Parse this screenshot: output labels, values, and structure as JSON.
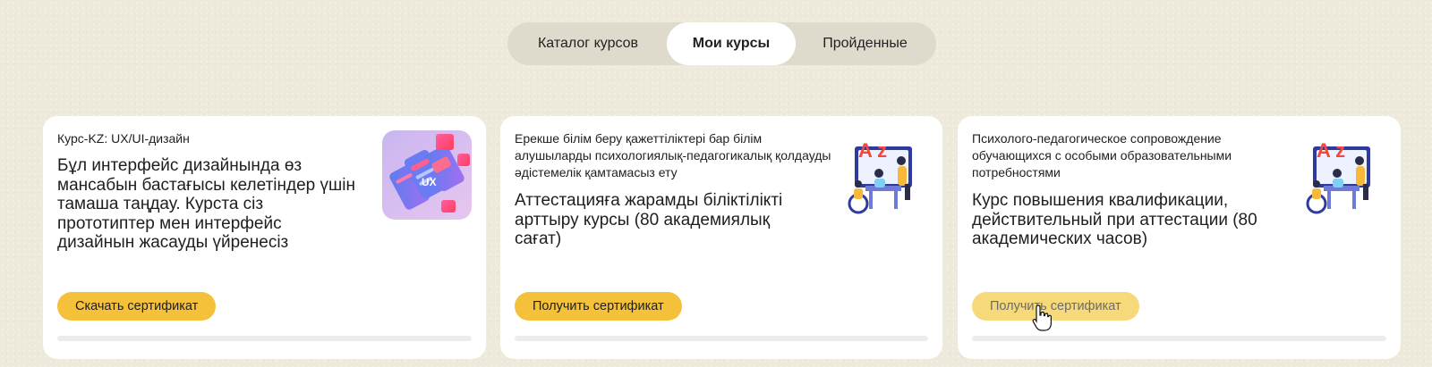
{
  "tabs": {
    "catalog": "Каталог курсов",
    "my": "Мои курсы",
    "done": "Пройденные"
  },
  "cards": [
    {
      "subtitle": "Курс-KZ: UX/UI-дизайн",
      "description": "Бұл интерфейс дизайнында өз мансабын бастағысы келетіндер үшін тамаша таңдау. Курста сіз прототиптер мен интерфейс дизайнын жасауды үйренесіз",
      "button": "Скачать сертификат",
      "thumb_icon": "ux-ui-phones-illustration"
    },
    {
      "subtitle": "Ерекше білім беру қажеттіліктері бар білім алушыларды психологиялық-педагогикалық қолдауды әдістемелік қамтамасыз ету",
      "description": "Аттестацияға жарамды біліктілікті арттыру курсы (80 академиялық сағат)",
      "button": "Получить сертификат",
      "thumb_icon": "classroom-az-illustration"
    },
    {
      "subtitle": "Психолого-педагогическое сопровождение обучающихся с особыми образовательными потребностями",
      "description": "Курс повышения квалификации, действительный при аттестации (80 академических часов)",
      "button": "Получить сертификат",
      "thumb_icon": "classroom-az-illustration"
    }
  ],
  "thumb_text": {
    "ux": "UX",
    "az": "A z"
  },
  "colors": {
    "accent": "#f5c13a",
    "accent_hover": "#f6d97a",
    "page_bg": "#eeeadb",
    "tabs_bg": "#dedbcd"
  }
}
